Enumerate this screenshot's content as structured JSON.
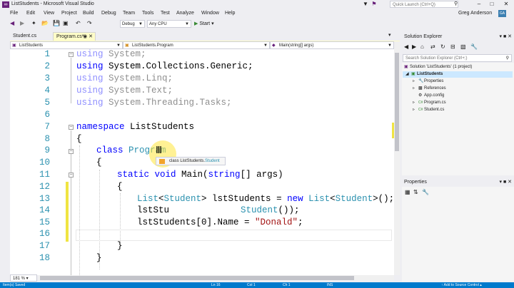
{
  "window": {
    "title": "ListStudents - Microsoft Visual Studio"
  },
  "quick_launch": {
    "placeholder": "Quick Launch (Ctrl+Q)"
  },
  "menu": [
    "File",
    "Edit",
    "View",
    "Project",
    "Build",
    "Debug",
    "Team",
    "Tools",
    "Test",
    "Analyze",
    "Window",
    "Help"
  ],
  "user": {
    "name": "Greg Anderson",
    "initials": "GA"
  },
  "toolbar": {
    "config": "Debug",
    "platform": "Any CPU",
    "start": "Start"
  },
  "tabs": [
    {
      "label": "Student.cs"
    },
    {
      "label": "Program.cs*",
      "active": true
    }
  ],
  "navbar": {
    "project": "ListStudents",
    "type": "ListStudents.Program",
    "member": "Main(string[] args)"
  },
  "editor": {
    "line_numbers": [
      "1",
      "2",
      "3",
      "4",
      "5",
      "6",
      "7",
      "8",
      "9",
      "10",
      "11",
      "12",
      "13",
      "14",
      "15",
      "16",
      "17",
      "18"
    ],
    "lines": {
      "l1_kw": "using",
      "l1_rest": " System;",
      "l2_kw": "using",
      "l2_rest": " System.Collections.Generic;",
      "l3_kw": "using",
      "l3_rest": " System.Linq;",
      "l4_kw": "using",
      "l4_rest": " System.Text;",
      "l5_kw": "using",
      "l5_rest": " System.Threading.Tasks;",
      "l7_kw": "namespace",
      "l7_rest": " ListStudents",
      "l8": "{",
      "l9_kw": "class",
      "l9_type": " Program",
      "l10": "{",
      "l11_kw1": "static",
      "l11_kw2": " void",
      "l11_a": " Main(",
      "l11_kw3": "string",
      "l11_b": "[] args)",
      "l12": "{",
      "l13_t1": "List",
      "l13_a": "<",
      "l13_t2": "Student",
      "l13_b": "> lstStudents = ",
      "l13_kw": "new",
      "l13_sp": " ",
      "l13_t3": "List",
      "l13_c": "<",
      "l13_t4": "Student",
      "l13_d": ">();",
      "l14_a": "lstStu",
      "l14_t": "Student",
      "l14_b": "());",
      "l15_a": "lstStudents[0].Name = ",
      "l15_str": "\"Donald\"",
      "l15_b": ";",
      "l17": "}",
      "l18": "}"
    },
    "tooltip": {
      "prefix": "class ListStudents.",
      "cls": "Student"
    }
  },
  "zoom": "181 %",
  "statusbar": {
    "left": "Item(s) Saved",
    "ln": "Ln 16",
    "col": "Col 1",
    "ch": "Ch 1",
    "ins": "INS",
    "source_control": "↑ Add to Source Control ▴"
  },
  "solution_explorer": {
    "title": "Solution Explorer",
    "search_placeholder": "Search Solution Explorer (Ctrl+;)",
    "items": [
      {
        "label": "Solution 'ListStudents' (1 project)"
      },
      {
        "label": "ListStudents"
      },
      {
        "label": "Properties"
      },
      {
        "label": "References"
      },
      {
        "label": "App.config"
      },
      {
        "label": "Program.cs"
      },
      {
        "label": "Student.cs"
      }
    ]
  },
  "properties": {
    "title": "Properties"
  },
  "colors": {
    "accent": "#007acc",
    "brand": "#68217a",
    "keyword": "#0000ff",
    "type": "#2b91af",
    "string": "#a31515"
  }
}
